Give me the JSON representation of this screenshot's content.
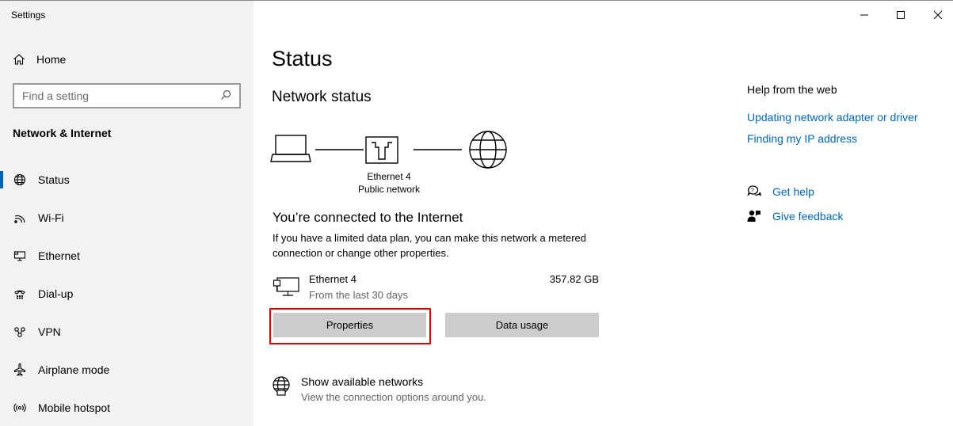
{
  "window": {
    "title": "Settings"
  },
  "sidebar": {
    "home_label": "Home",
    "search_placeholder": "Find a setting",
    "section_title": "Network & Internet",
    "items": [
      {
        "label": "Status",
        "icon": "globe-icon",
        "active": true
      },
      {
        "label": "Wi-Fi",
        "icon": "wifi-icon"
      },
      {
        "label": "Ethernet",
        "icon": "ethernet-icon"
      },
      {
        "label": "Dial-up",
        "icon": "dialup-icon"
      },
      {
        "label": "VPN",
        "icon": "vpn-icon"
      },
      {
        "label": "Airplane mode",
        "icon": "airplane-icon"
      },
      {
        "label": "Mobile hotspot",
        "icon": "hotspot-icon"
      }
    ]
  },
  "main": {
    "title": "Status",
    "network_status": "Network status",
    "adapter_name": "Ethernet 4",
    "network_type": "Public network",
    "connected_heading": "You’re connected to the Internet",
    "connected_desc": "If you have a limited data plan, you can make this network a metered connection or change other properties.",
    "usage": {
      "name": "Ethernet 4",
      "period": "From the last 30 days",
      "amount": "357.82 GB"
    },
    "properties_button": "Properties",
    "data_usage_button": "Data usage",
    "show_networks": {
      "title": "Show available networks",
      "subtitle": "View the connection options around you."
    }
  },
  "right": {
    "help_heading": "Help from the web",
    "links": [
      "Updating network adapter or driver",
      "Finding my IP address"
    ],
    "get_help": "Get help",
    "give_feedback": "Give feedback"
  },
  "colors": {
    "accent": "#0063b1",
    "link": "#0067b8",
    "highlight": "#e00000",
    "sidebar_bg": "#f2f2f2",
    "button_bg": "#cccccc"
  }
}
